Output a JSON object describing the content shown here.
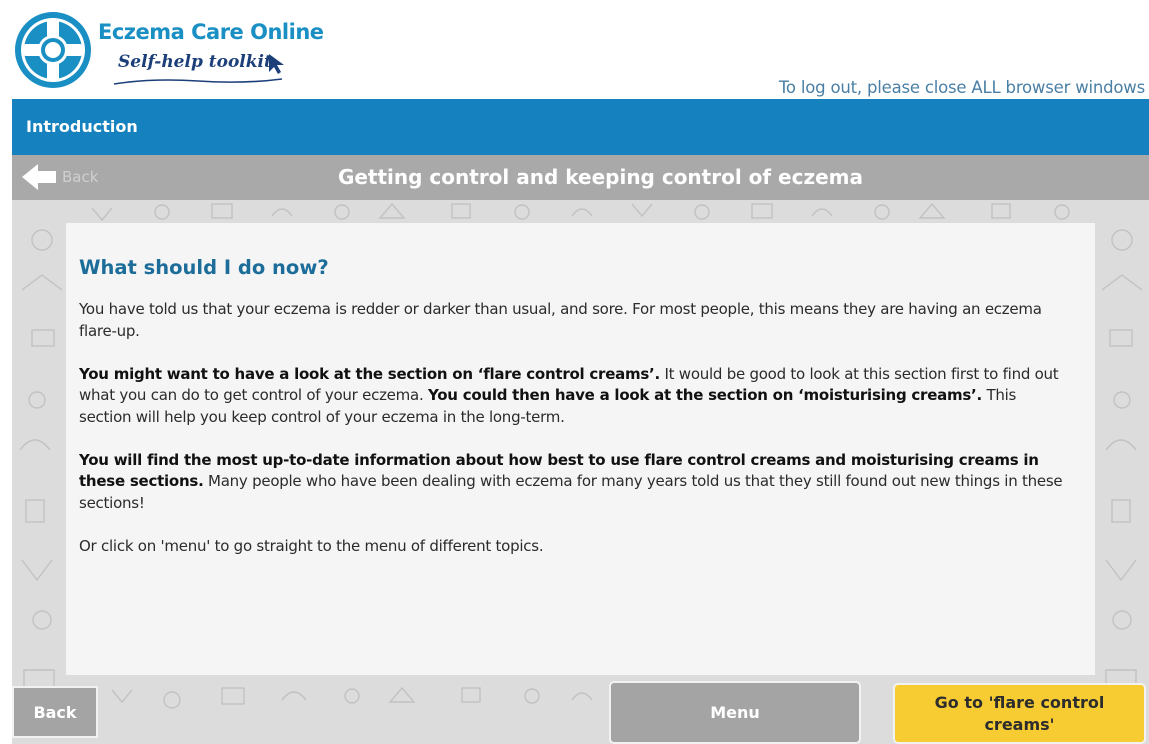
{
  "header": {
    "brand_title": "Eczema Care Online",
    "brand_subtitle": "Self-help toolkit",
    "logout_note": "To log out, please close ALL browser windows"
  },
  "section": {
    "label": "Introduction"
  },
  "title_bar": {
    "back_label": "Back",
    "page_title": "Getting control and keeping control of eczema"
  },
  "content": {
    "heading": "What should I do now?",
    "p1": "You have told us that your eczema is redder or darker than usual, and sore. For most people, this means they are having an eczema flare-up.",
    "p2_bold1": "You might want to have a look at the section on ‘flare control creams’.",
    "p2_text1": " It would be good to look at this section first to find out what you can do to get control of your eczema. ",
    "p2_bold2": "You could then have a look at the section on ‘moisturising creams’.",
    "p2_text2": " This section will help you keep control of your eczema in the long-term.",
    "p3_bold": "You will find the most up-to-date information about how best to use flare control creams and moisturising creams in these sections.",
    "p3_text": " Many people who have been dealing with eczema for many years told us that they still found out new things in these sections!",
    "p4": "Or click on 'menu' to go straight to the menu of different topics."
  },
  "footer": {
    "back_label": "Back",
    "menu_label": "Menu",
    "flare_label": "Go to 'flare control creams'"
  },
  "colors": {
    "brand_blue": "#1582bf",
    "title_grey": "#a9a9a9",
    "heading_blue": "#1c6d9a",
    "cta_yellow": "#f7cc33"
  },
  "icons": {
    "logo": "lifebuoy-icon",
    "cursor": "cursor-arrow-icon",
    "back": "back-arrow-icon"
  }
}
